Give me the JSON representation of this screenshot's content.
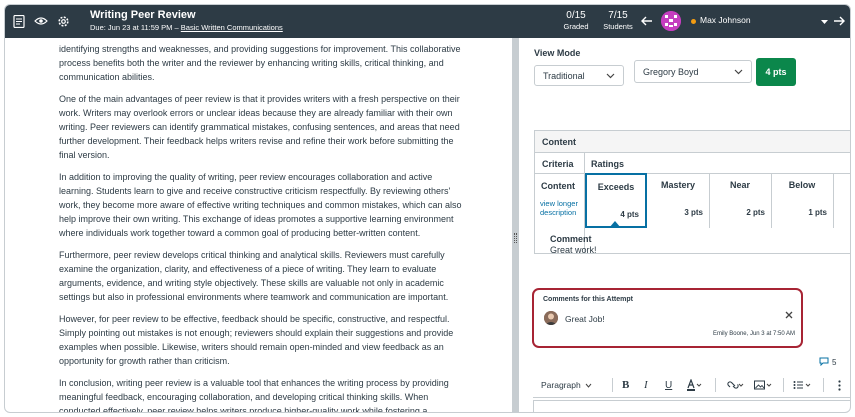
{
  "header": {
    "title": "Writing Peer Review",
    "due": "Due: Jun 23 at 11:59 PM",
    "sep": "–",
    "course": "Basic Written Communications",
    "graded_num": "0/15",
    "graded_label": "Graded",
    "students_num": "7/15",
    "students_label": "Students",
    "student_name": "Max Johnson",
    "colors": {
      "bar": "#2d3b45",
      "status_dot": "#f39c12"
    }
  },
  "document": {
    "paragraphs": [
      "identifying strengths and weaknesses, and providing suggestions for improvement. This collaborative process benefits both the writer and the reviewer by enhancing writing skills, critical thinking, and communication abilities.",
      "One of the main advantages of peer review is that it provides writers with a fresh perspective on their work. Writers may overlook errors or unclear ideas because they are already familiar with their own writing. Peer reviewers can identify grammatical mistakes, confusing sentences, and areas that need further development. Their feedback helps writers revise and refine their work before submitting the final version.",
      "In addition to improving the quality of writing, peer review encourages collaboration and active learning. Students learn to give and receive constructive criticism respectfully. By reviewing others' work, they become more aware of effective writing techniques and common mistakes, which can also help improve their own writing. This exchange of ideas promotes a supportive learning environment where individuals work together toward a common goal of producing better-written content.",
      "Furthermore, peer review develops critical thinking and analytical skills. Reviewers must carefully examine the organization, clarity, and effectiveness of a piece of writing. They learn to evaluate arguments, evidence, and writing style objectively. These skills are valuable not only in academic settings but also in professional environments where teamwork and communication are important.",
      "However, for peer review to be effective, feedback should be specific, constructive, and respectful. Simply pointing out mistakes is not enough; reviewers should explain their suggestions and provide examples when possible. Likewise, writers should remain open-minded and view feedback as an opportunity for growth rather than criticism.",
      "In conclusion, writing peer review is a valuable tool that enhances the writing process by providing meaningful feedback, encouraging collaboration, and developing critical thinking skills. When conducted effectively, peer review helps writers produce higher-quality work while fostering a"
    ]
  },
  "grading": {
    "view_mode_label": "View Mode",
    "view_mode_value": "Traditional",
    "grader_value": "Gregory Boyd",
    "score_button": "4 pts",
    "colors": {
      "score": "#0b874b"
    }
  },
  "rubric": {
    "title": "Content",
    "criteria_header": "Criteria",
    "ratings_header": "Ratings",
    "criterion_name": "Content",
    "criterion_link": "view longer description",
    "ratings": [
      {
        "name": "Exceeds",
        "pts": "4 pts",
        "selected": true
      },
      {
        "name": "Mastery",
        "pts": "3 pts"
      },
      {
        "name": "Near",
        "pts": "2 pts"
      },
      {
        "name": "Below",
        "pts": "1 pts"
      }
    ],
    "comment_label": "Comment",
    "comment_value": "Great work!",
    "colors": {
      "selected": "#0770a3"
    }
  },
  "attempt_comments": {
    "title": "Comments for this Attempt",
    "text": "Great Job!",
    "meta": "Emily Boone, Jun 3 at 7:50 AM",
    "colors": {
      "highlight": "#a72434"
    }
  },
  "comment_count": "5",
  "editor": {
    "format_label": "Paragraph"
  }
}
